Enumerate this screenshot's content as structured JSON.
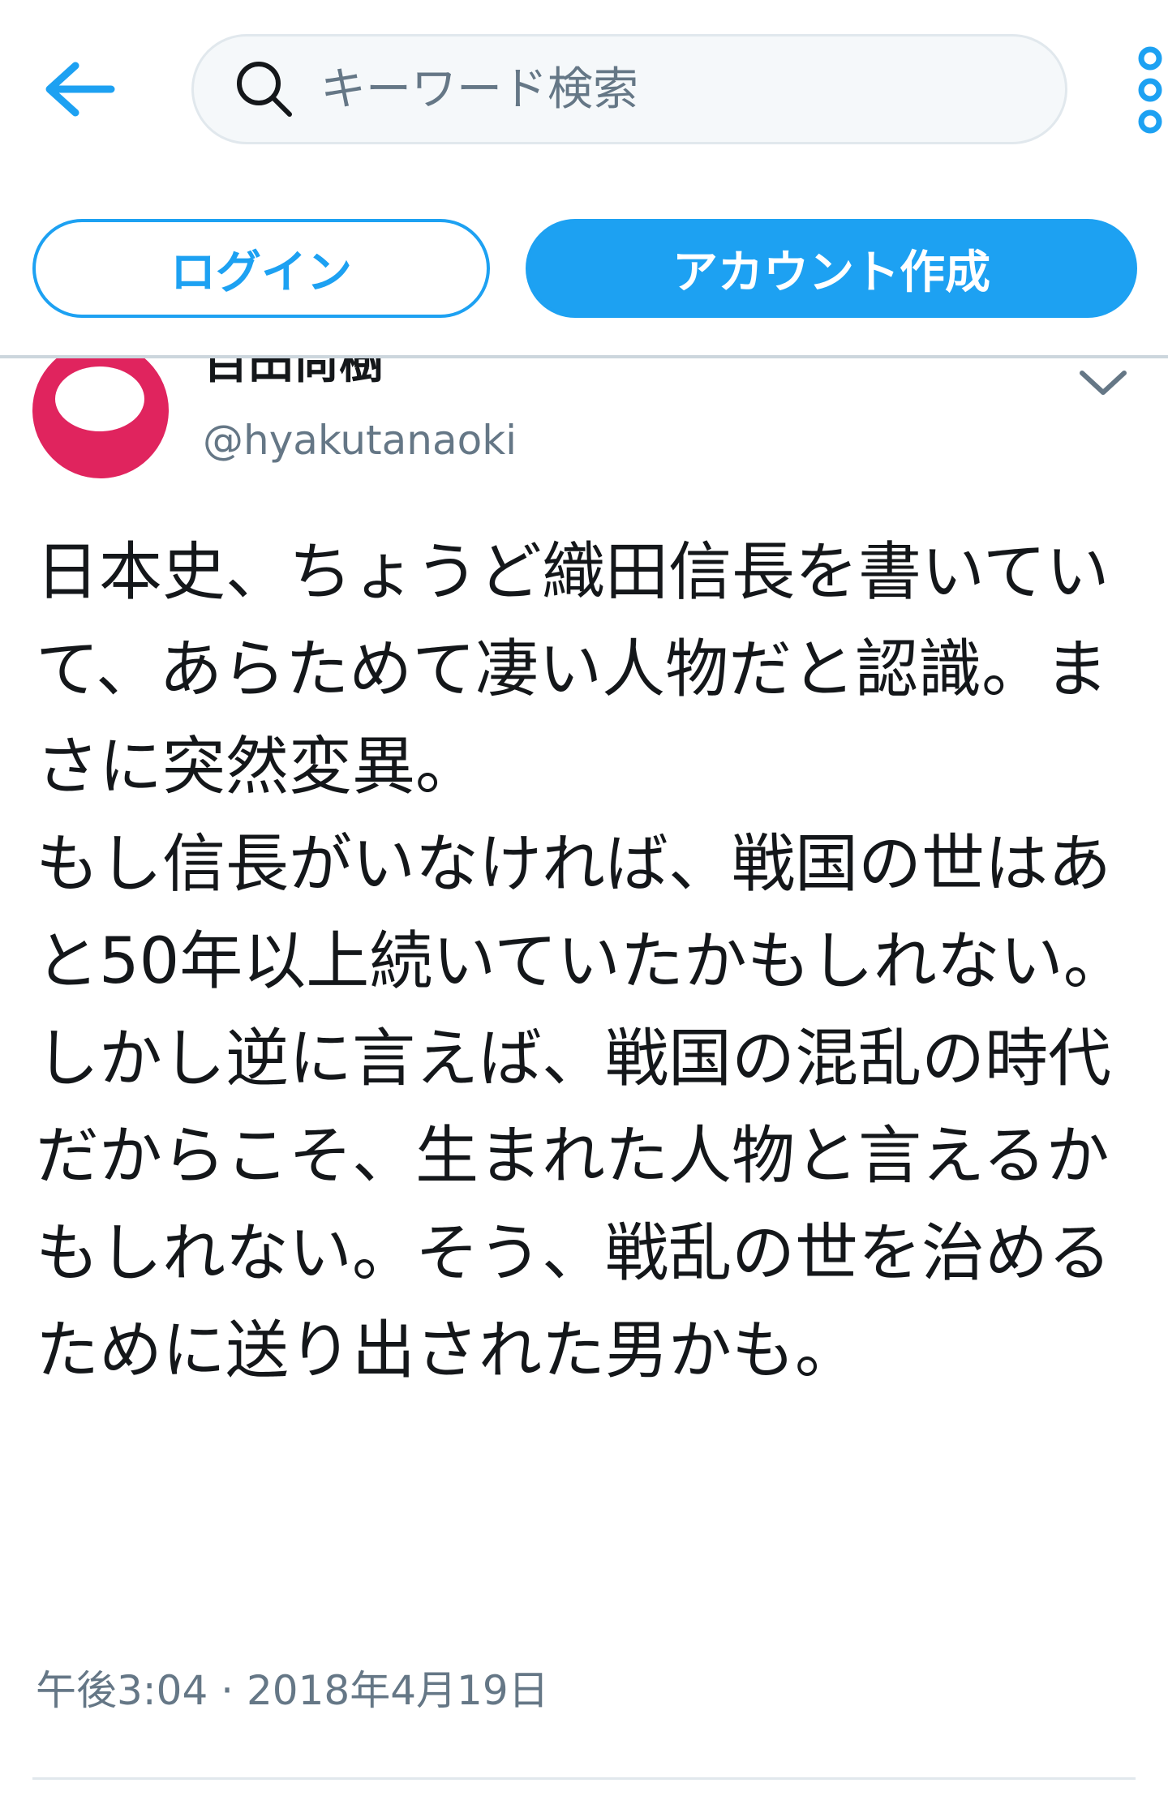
{
  "colors": {
    "accent": "#1da1f2",
    "text_primary": "#14171a",
    "text_secondary": "#657786",
    "avatar_bg": "#e0245e",
    "search_bg": "#f5f8fa",
    "divider": "#ccd6dd"
  },
  "header": {
    "back_icon": "arrow-left-icon",
    "search": {
      "icon": "search-icon",
      "placeholder": "キーワード検索",
      "value": ""
    },
    "more_icon": "vertical-dots-icon"
  },
  "auth": {
    "login_label": "ログイン",
    "signup_label": "アカウント作成"
  },
  "tweet": {
    "author": {
      "display_name": "百田尚樹",
      "handle": "@hyakutanaoki",
      "avatar_icon": "avatar-image"
    },
    "caret_icon": "chevron-down-icon",
    "text_lines": [
      "日本史、ちょうど織田信長を書いていて、あらためて凄い人物だと認識。まさに突然変異。",
      "もし信長がいなければ、戦国の世はあと50年以上続いていたかもしれない。",
      "しかし逆に言えば、戦国の混乱の時代だからこそ、生まれた人物と言えるかもしれない。そう、戦乱の世を治めるために送り出された男かも。"
    ],
    "timestamp": "午後3:04 · 2018年4月19日"
  }
}
